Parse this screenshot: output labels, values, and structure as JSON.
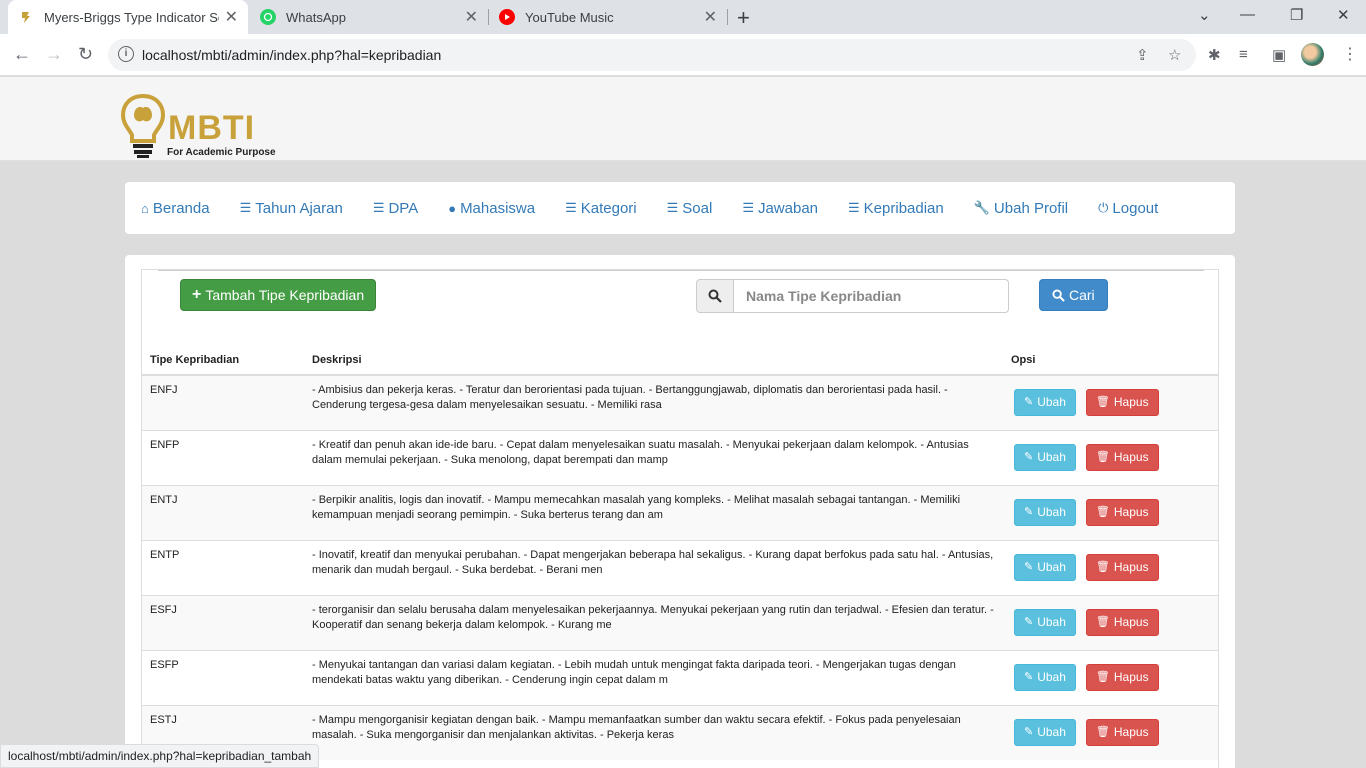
{
  "browser": {
    "tabs": [
      {
        "title": "Myers-Briggs Type Indicator Scal",
        "active": true,
        "favicon": "mbti-favicon"
      },
      {
        "title": "WhatsApp",
        "active": false,
        "favicon": "whatsapp-icon"
      },
      {
        "title": "YouTube Music",
        "active": false,
        "favicon": "youtube-music-icon"
      }
    ],
    "url": "localhost/mbti/admin/index.php?hal=kepribadian",
    "status_url": "localhost/mbti/admin/index.php?hal=kepribadian_tambah"
  },
  "logo": {
    "word": "MBTI",
    "tagline": "For Academic Purpose"
  },
  "nav": [
    {
      "label": "Beranda",
      "icon": "home-icon"
    },
    {
      "label": "Tahun Ajaran",
      "icon": "list-icon"
    },
    {
      "label": "DPA",
      "icon": "list-icon"
    },
    {
      "label": "Mahasiswa",
      "icon": "user-icon"
    },
    {
      "label": "Kategori",
      "icon": "list-icon"
    },
    {
      "label": "Soal",
      "icon": "list-icon"
    },
    {
      "label": "Jawaban",
      "icon": "list-icon"
    },
    {
      "label": "Kepribadian",
      "icon": "list-icon"
    },
    {
      "label": "Ubah Profil",
      "icon": "wrench-icon"
    },
    {
      "label": "Logout",
      "icon": "power-icon"
    }
  ],
  "toolbar": {
    "add_label": "Tambah Tipe Kepribadian",
    "search_placeholder": "Nama Tipe Kepribadian",
    "search_button": "Cari"
  },
  "table": {
    "headers": [
      "Tipe Kepribadian",
      "Deskripsi",
      "Opsi"
    ],
    "edit_label": "Ubah",
    "delete_label": "Hapus",
    "rows": [
      {
        "tipe": "ENFJ",
        "deskripsi": "- Ambisius dan pekerja keras. - Teratur dan berorientasi pada tujuan. - Bertanggungjawab, diplomatis dan berorientasi pada hasil. - Cenderung tergesa-gesa dalam menyelesaikan sesuatu. - Memiliki rasa"
      },
      {
        "tipe": "ENFP",
        "deskripsi": "- Kreatif dan penuh akan ide-ide baru. - Cepat dalam menyelesaikan suatu masalah. - Menyukai pekerjaan dalam kelompok. - Antusias dalam memulai pekerjaan. - Suka menolong, dapat berempati dan mamp"
      },
      {
        "tipe": "ENTJ",
        "deskripsi": "- Berpikir analitis, logis dan inovatif. - Mampu memecahkan masalah yang kompleks. - Melihat masalah sebagai tantangan. - Memiliki kemampuan menjadi seorang pemimpin. - Suka berterus terang dan am"
      },
      {
        "tipe": "ENTP",
        "deskripsi": "- Inovatif, kreatif dan menyukai perubahan. - Dapat mengerjakan beberapa hal sekaligus. - Kurang dapat berfokus pada satu hal. - Antusias, menarik dan mudah bergaul. - Suka berdebat. - Berani men"
      },
      {
        "tipe": "ESFJ",
        "deskripsi": "- terorganisir dan selalu berusaha dalam menyelesaikan pekerjaannya. Menyukai pekerjaan yang rutin dan terjadwal. - Efesien dan teratur. - Kooperatif dan senang bekerja dalam kelompok. - Kurang me"
      },
      {
        "tipe": "ESFP",
        "deskripsi": "- Menyukai tantangan dan variasi dalam kegiatan. - Lebih mudah untuk mengingat fakta daripada teori. - Mengerjakan tugas dengan mendekati batas waktu yang diberikan. - Cenderung ingin cepat dalam m"
      },
      {
        "tipe": "ESTJ",
        "deskripsi": "- Mampu mengorganisir kegiatan dengan baik. - Mampu memanfaatkan sumber dan waktu secara efektif. - Fokus pada penyelesaian masalah. - Suka mengorganisir dan menjalankan aktivitas. - Pekerja keras"
      }
    ]
  },
  "colors": {
    "brand_gold": "#c9a13b",
    "link_blue": "#337ab7",
    "success": "#449d44",
    "primary": "#428bca",
    "info": "#5bc0de",
    "danger": "#d9534f"
  }
}
